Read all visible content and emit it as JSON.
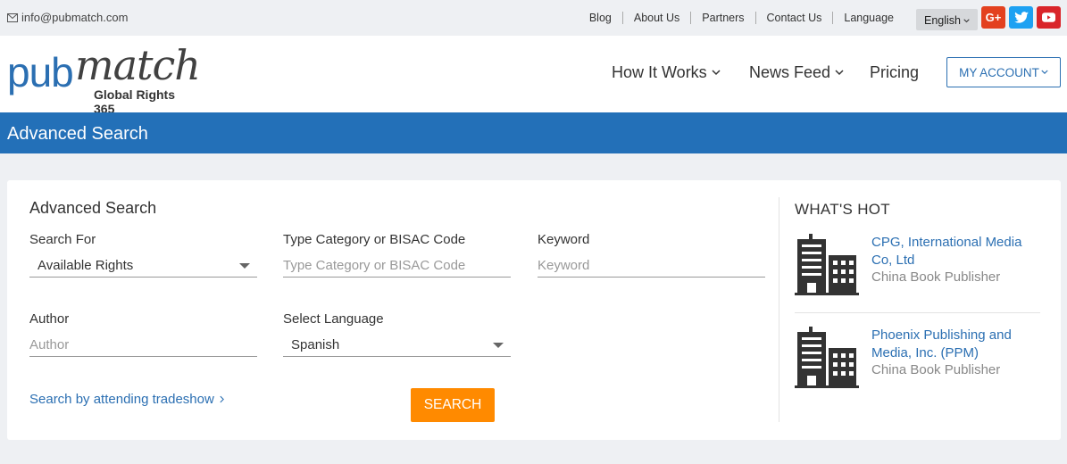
{
  "topbar": {
    "email": "info@pubmatch.com",
    "links": [
      "Blog",
      "About Us",
      "Partners",
      "Contact Us",
      "Language"
    ],
    "language_selected": "English",
    "social": [
      "google-plus-icon",
      "twitter-icon",
      "youtube-icon"
    ]
  },
  "logo": {
    "pub": "pub",
    "match": "match",
    "tagline": "Global Rights 365"
  },
  "nav": {
    "how_it_works": "How It Works",
    "news_feed": "News Feed",
    "pricing": "Pricing",
    "my_account": "MY ACCOUNT"
  },
  "banner": {
    "title": "Advanced Search"
  },
  "form": {
    "title": "Advanced Search",
    "search_for": {
      "label": "Search For",
      "value": "Available Rights"
    },
    "category": {
      "label": "Type Category or BISAC Code",
      "placeholder": "Type Category or BISAC Code"
    },
    "keyword": {
      "label": "Keyword",
      "placeholder": "Keyword"
    },
    "author": {
      "label": "Author",
      "placeholder": "Author"
    },
    "language": {
      "label": "Select Language",
      "value": "Spanish"
    },
    "tradeshow_link": "Search by attending tradeshow",
    "search_button": "SEARCH"
  },
  "whats_hot": {
    "title": "WHAT'S HOT",
    "items": [
      {
        "name": "CPG, International Media Co, Ltd",
        "type": "China Book Publisher"
      },
      {
        "name": "Phoenix Publishing and Media, Inc. (PPM)",
        "type": "China Book Publisher"
      }
    ]
  },
  "colors": {
    "brand_blue": "#2370b8",
    "link_blue": "#2b6fb2",
    "search_orange": "#ff8a00"
  }
}
